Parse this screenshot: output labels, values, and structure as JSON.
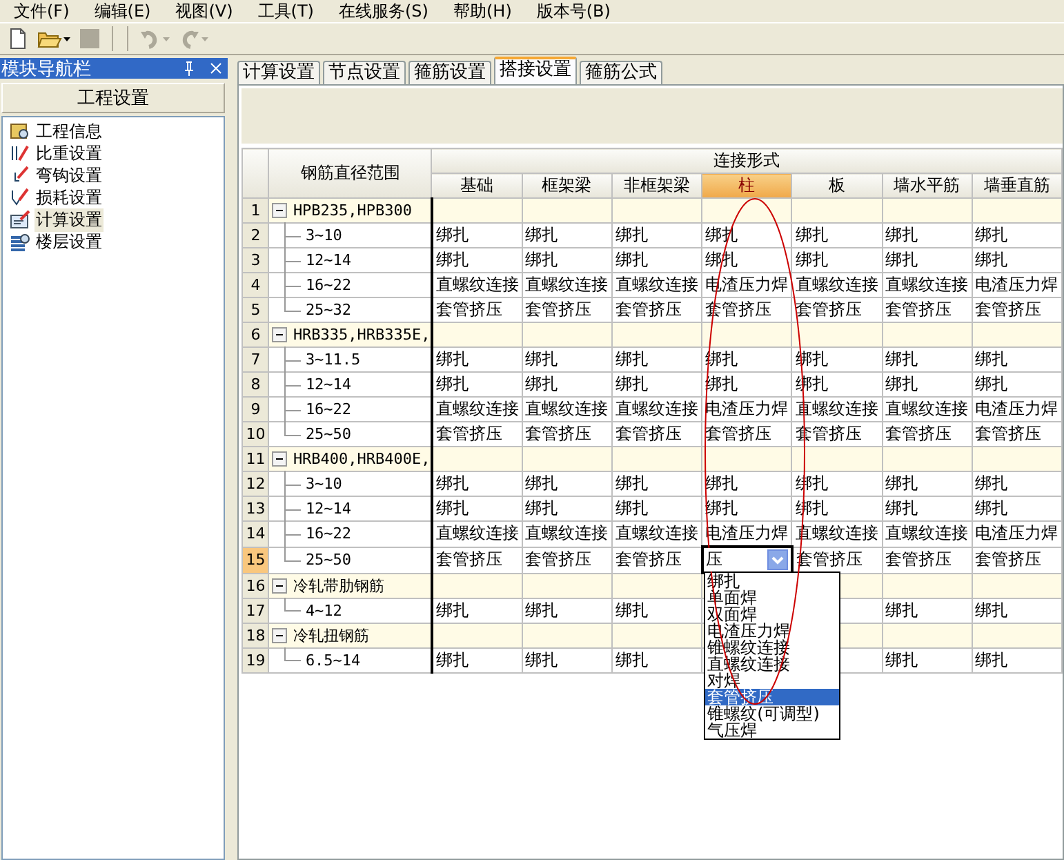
{
  "menu": [
    "文件(F)",
    "编辑(E)",
    "视图(V)",
    "工具(T)",
    "在线服务(S)",
    "帮助(H)",
    "版本号(B)"
  ],
  "toolbar": [
    {
      "kind": "new",
      "disabled": false
    },
    {
      "kind": "open",
      "disabled": false,
      "dropdown": true
    },
    {
      "kind": "save",
      "disabled": true
    },
    {
      "kind": "undo",
      "disabled": true,
      "dropdown": true
    },
    {
      "kind": "redo",
      "disabled": true,
      "dropdown": true
    }
  ],
  "nav": {
    "title": "模块导航栏",
    "section": "工程设置",
    "items": [
      {
        "label": "工程信息",
        "kind": "info",
        "selected": false
      },
      {
        "label": "比重设置",
        "kind": "weight",
        "selected": false
      },
      {
        "label": "弯钩设置",
        "kind": "hook",
        "selected": false
      },
      {
        "label": "损耗设置",
        "kind": "loss",
        "selected": false
      },
      {
        "label": "计算设置",
        "kind": "calc",
        "selected": true
      },
      {
        "label": "楼层设置",
        "kind": "floor",
        "selected": false
      }
    ]
  },
  "tabs": [
    {
      "label": "计算设置",
      "selected": false
    },
    {
      "label": "节点设置",
      "selected": false
    },
    {
      "label": "箍筋设置",
      "selected": false
    },
    {
      "label": "搭接设置",
      "selected": true
    },
    {
      "label": "箍筋公式",
      "selected": false
    }
  ],
  "table": {
    "range_header": "钢筋直径范围",
    "group_header": "连接形式",
    "columns": [
      {
        "label": "基础",
        "selected": false
      },
      {
        "label": "框架梁",
        "selected": false
      },
      {
        "label": "非框架梁",
        "selected": false
      },
      {
        "label": "柱",
        "selected": true
      },
      {
        "label": "板",
        "selected": false
      },
      {
        "label": "墙水平筋",
        "selected": false
      },
      {
        "label": "墙垂直筋",
        "selected": false
      }
    ],
    "groups": [
      {
        "num": "1",
        "label": "HPB235,HPB300",
        "expanded": true,
        "selected": false,
        "children": [
          {
            "num": "2",
            "label": "3~10",
            "selected": false,
            "cells": [
              "绑扎",
              "绑扎",
              "绑扎",
              "绑扎",
              "绑扎",
              "绑扎",
              "绑扎"
            ]
          },
          {
            "num": "3",
            "label": "12~14",
            "selected": false,
            "cells": [
              "绑扎",
              "绑扎",
              "绑扎",
              "绑扎",
              "绑扎",
              "绑扎",
              "绑扎"
            ]
          },
          {
            "num": "4",
            "label": "16~22",
            "selected": false,
            "cells": [
              "直螺纹连接",
              "直螺纹连接",
              "直螺纹连接",
              "电渣压力焊",
              "直螺纹连接",
              "直螺纹连接",
              "电渣压力焊"
            ]
          },
          {
            "num": "5",
            "label": "25~32",
            "selected": false,
            "cells": [
              "套管挤压",
              "套管挤压",
              "套管挤压",
              "套管挤压",
              "套管挤压",
              "套管挤压",
              "套管挤压"
            ]
          }
        ]
      },
      {
        "num": "6",
        "label": "HRB335,HRB335E,",
        "expanded": true,
        "selected": false,
        "children": [
          {
            "num": "7",
            "label": "3~11.5",
            "selected": false,
            "cells": [
              "绑扎",
              "绑扎",
              "绑扎",
              "绑扎",
              "绑扎",
              "绑扎",
              "绑扎"
            ]
          },
          {
            "num": "8",
            "label": "12~14",
            "selected": false,
            "cells": [
              "绑扎",
              "绑扎",
              "绑扎",
              "绑扎",
              "绑扎",
              "绑扎",
              "绑扎"
            ]
          },
          {
            "num": "9",
            "label": "16~22",
            "selected": false,
            "cells": [
              "直螺纹连接",
              "直螺纹连接",
              "直螺纹连接",
              "电渣压力焊",
              "直螺纹连接",
              "直螺纹连接",
              "电渣压力焊"
            ]
          },
          {
            "num": "10",
            "label": "25~50",
            "selected": false,
            "cells": [
              "套管挤压",
              "套管挤压",
              "套管挤压",
              "套管挤压",
              "套管挤压",
              "套管挤压",
              "套管挤压"
            ]
          }
        ]
      },
      {
        "num": "11",
        "label": "HRB400,HRB400E,",
        "expanded": true,
        "selected": false,
        "children": [
          {
            "num": "12",
            "label": "3~10",
            "selected": false,
            "cells": [
              "绑扎",
              "绑扎",
              "绑扎",
              "绑扎",
              "绑扎",
              "绑扎",
              "绑扎"
            ]
          },
          {
            "num": "13",
            "label": "12~14",
            "selected": false,
            "cells": [
              "绑扎",
              "绑扎",
              "绑扎",
              "绑扎",
              "绑扎",
              "绑扎",
              "绑扎"
            ]
          },
          {
            "num": "14",
            "label": "16~22",
            "selected": false,
            "cells": [
              "直螺纹连接",
              "直螺纹连接",
              "直螺纹连接",
              "电渣压力焊",
              "直螺纹连接",
              "直螺纹连接",
              "电渣压力焊"
            ]
          },
          {
            "num": "15",
            "label": "25~50",
            "selected": true,
            "cells": [
              "套管挤压",
              "套管挤压",
              "套管挤压",
              {
                "kind": "combo",
                "value": "压",
                "options": [
                  {
                    "label": "绑扎",
                    "selected": false
                  },
                  {
                    "label": "单面焊",
                    "selected": false
                  },
                  {
                    "label": "双面焊",
                    "selected": false
                  },
                  {
                    "label": "电渣压力焊",
                    "selected": false
                  },
                  {
                    "label": "锥螺纹连接",
                    "selected": false
                  },
                  {
                    "label": "直螺纹连接",
                    "selected": false
                  },
                  {
                    "label": "对焊",
                    "selected": false
                  },
                  {
                    "label": "套管挤压",
                    "selected": true
                  },
                  {
                    "label": "锥螺纹(可调型)",
                    "selected": false
                  },
                  {
                    "label": "气压焊",
                    "selected": false
                  }
                ]
              },
              "套管挤压",
              "套管挤压",
              "套管挤压"
            ]
          }
        ]
      },
      {
        "num": "16",
        "label": "冷轧带肋钢筋",
        "expanded": true,
        "selected": false,
        "children": [
          {
            "num": "17",
            "label": "4~12",
            "selected": false,
            "cells": [
              "绑扎",
              "绑扎",
              "绑扎",
              null,
              null,
              "绑扎",
              "绑扎"
            ]
          }
        ]
      },
      {
        "num": "18",
        "label": "冷轧扭钢筋",
        "expanded": true,
        "selected": false,
        "children": [
          {
            "num": "19",
            "label": "6.5~14",
            "selected": false,
            "cells": [
              "绑扎",
              "绑扎",
              "绑扎",
              null,
              null,
              "绑扎",
              "绑扎"
            ]
          }
        ]
      }
    ]
  }
}
